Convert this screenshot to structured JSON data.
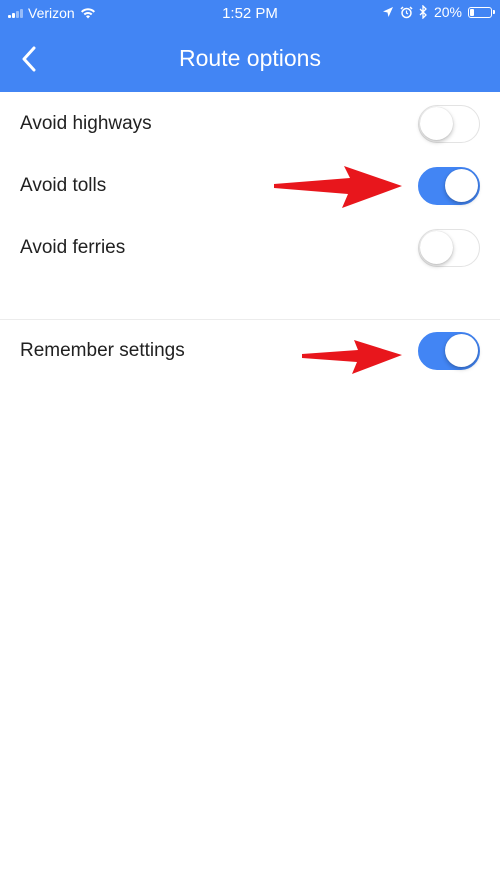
{
  "status_bar": {
    "carrier": "Verizon",
    "time": "1:52 PM",
    "battery_percent": "20%",
    "battery_level": 0.2
  },
  "header": {
    "title": "Route options",
    "back_icon": "chevron-left-icon"
  },
  "options": [
    {
      "label": "Avoid highways",
      "enabled": false
    },
    {
      "label": "Avoid tolls",
      "enabled": true
    },
    {
      "label": "Avoid ferries",
      "enabled": false
    }
  ],
  "remember": {
    "label": "Remember settings",
    "enabled": true
  },
  "colors": {
    "accent": "#4285f4",
    "annotation_arrow": "#e8161c"
  }
}
